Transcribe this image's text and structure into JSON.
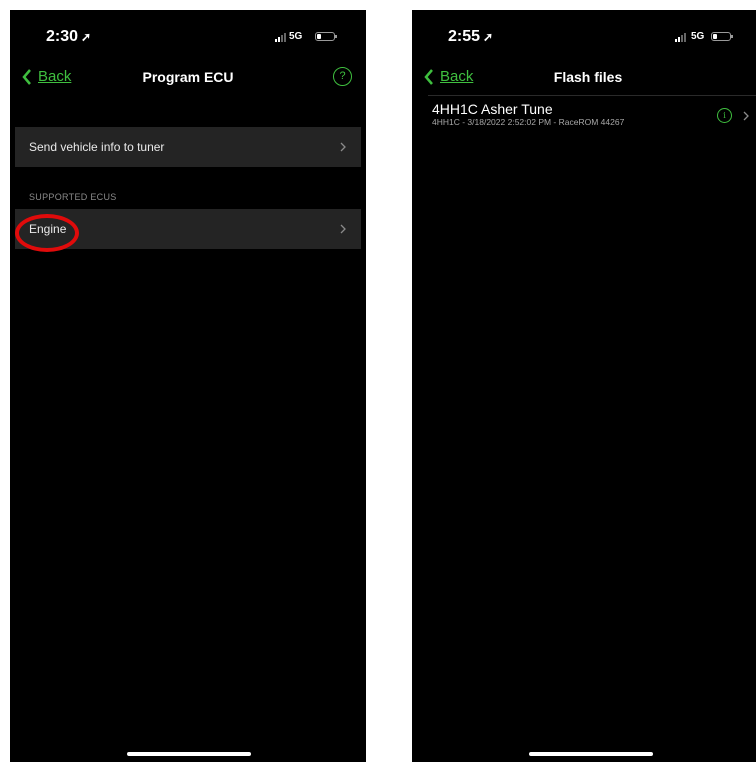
{
  "left_screen": {
    "status": {
      "time": "2:30",
      "network": "5G"
    },
    "nav": {
      "back_label": "Back",
      "title": "Program ECU"
    },
    "help_label": "?",
    "rows": [
      {
        "label": "Send vehicle info to tuner"
      }
    ],
    "section_header": "SUPPORTED ECUS",
    "ecu_rows": [
      {
        "label": "Engine"
      }
    ],
    "highlight_color": "#e00b0b"
  },
  "right_screen": {
    "status": {
      "time": "2:55",
      "network": "5G"
    },
    "nav": {
      "back_label": "Back",
      "title": "Flash files"
    },
    "files": [
      {
        "name": "4HH1C Asher Tune",
        "details": "4HH1C - 3/18/2022 2:52:02 PM - RaceROM 44267"
      }
    ]
  },
  "colors": {
    "accent": "#3fbf3f",
    "background": "#000000",
    "row": "#242424"
  },
  "icons": [
    "location-arrow-icon",
    "signal-icon",
    "battery-icon",
    "chevron-left-icon",
    "help-icon",
    "chevron-right-icon",
    "info-icon"
  ]
}
